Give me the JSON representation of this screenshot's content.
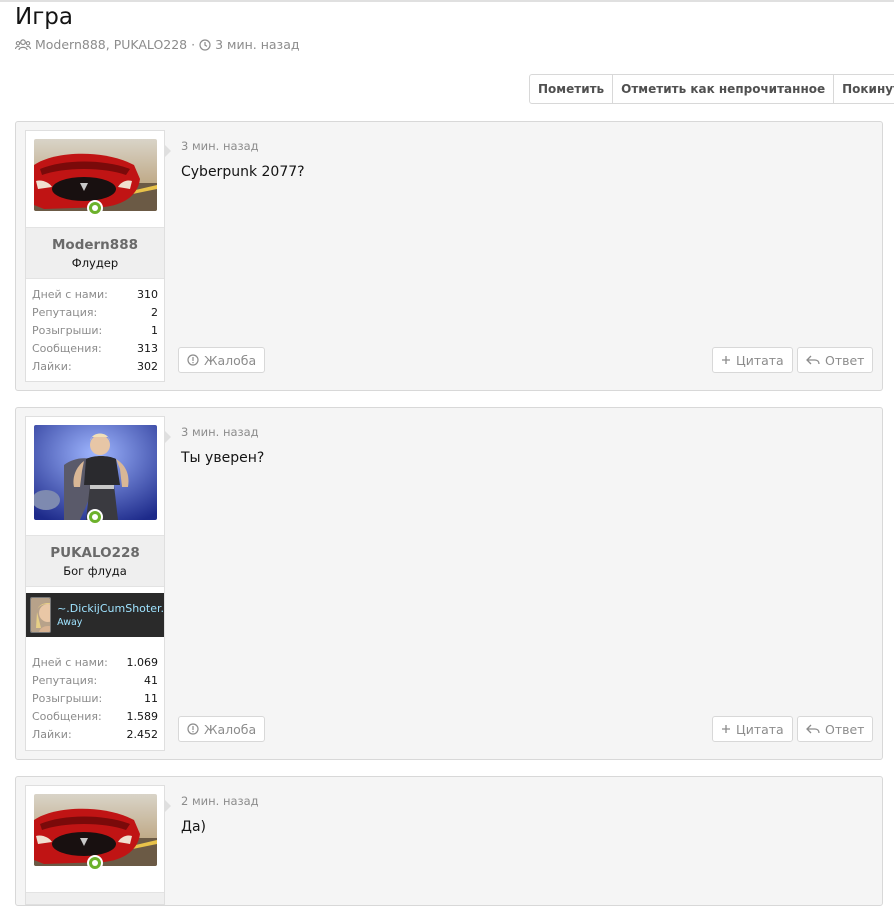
{
  "thread": {
    "title": "Игра",
    "participants": "Modern888, PUKALO228",
    "separator": "·",
    "time": "3 мин. назад"
  },
  "actions": [
    {
      "label": "Пометить"
    },
    {
      "label": "Отметить как непрочитанное"
    },
    {
      "label": "Покинуть"
    }
  ],
  "messages": [
    {
      "username": "Modern888",
      "user_title": "Флудер",
      "time": "3 мин. назад",
      "text": "Cyberpunk 2077?",
      "stats": [
        {
          "k": "Дней с нами:",
          "v": "310"
        },
        {
          "k": "Репутация:",
          "v": "2"
        },
        {
          "k": "Розыгрыши:",
          "v": "1"
        },
        {
          "k": "Сообщения:",
          "v": "313"
        },
        {
          "k": "Лайки:",
          "v": "302"
        }
      ],
      "report": "Жалоба",
      "quote": "Цитата",
      "reply": "Ответ"
    },
    {
      "username": "PUKALO228",
      "user_title": "Бог флуда",
      "time": "3 мин. назад",
      "text": "Ты уверен?",
      "banner_name": "~.DickijCumShoter.",
      "banner_status": "Away",
      "stats": [
        {
          "k": "Дней с нами:",
          "v": "1.069"
        },
        {
          "k": "Репутация:",
          "v": "41"
        },
        {
          "k": "Розыгрыши:",
          "v": "11"
        },
        {
          "k": "Сообщения:",
          "v": "1.589"
        },
        {
          "k": "Лайки:",
          "v": "2.452"
        }
      ],
      "report": "Жалоба",
      "quote": "Цитата",
      "reply": "Ответ"
    },
    {
      "time": "2 мин. назад",
      "text": "Да)"
    }
  ],
  "colors": {
    "online": "#6cb12b",
    "banner_text": "#9fe3ff"
  }
}
